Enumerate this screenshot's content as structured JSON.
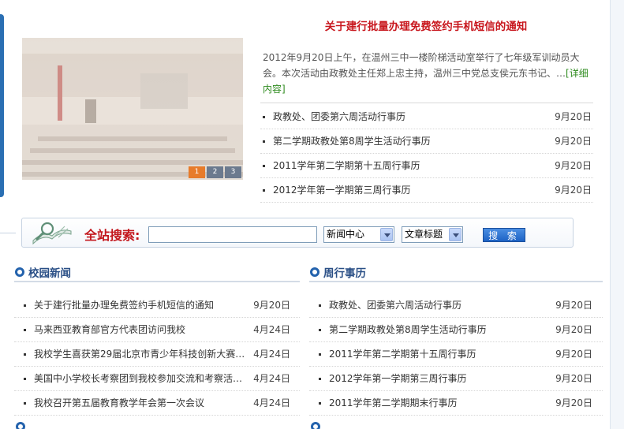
{
  "slideshow": {
    "pages": [
      "1",
      "2",
      "3"
    ],
    "active_page": 1
  },
  "headline": {
    "title": "关于建行批量办理免费签约手机短信的通知",
    "summary": "2012年9月20日上午，在温州三中一楼阶梯活动室举行了七年级军训动员大会。本次活动由政教处主任郑上忠主持，温州三中党总支侯元东书记、…",
    "more": "[详细内容]"
  },
  "top_list": [
    {
      "title": "政教处、团委第六周活动行事历",
      "date": "9月20日"
    },
    {
      "title": "第二学期政教处第8周学生活动行事历",
      "date": "9月20日"
    },
    {
      "title": "2011学年第二学期第十五周行事历",
      "date": "9月20日"
    },
    {
      "title": "2012学年第一学期第三周行事历",
      "date": "9月20日"
    }
  ],
  "search": {
    "title": "全站搜索:",
    "input_value": "",
    "category_selected": "新闻中心",
    "field_selected": "文章标题",
    "button": "搜 索"
  },
  "campus_news": {
    "title": "校园新闻",
    "items": [
      {
        "title": "关于建行批量办理免费签约手机短信的通知",
        "date": "9月20日"
      },
      {
        "title": "马来西亚教育部官方代表团访问我校",
        "date": "4月24日"
      },
      {
        "title": "我校学生喜获第29届北京市青少年科技创新大赛…",
        "date": "4月24日"
      },
      {
        "title": "美国中小学校长考察团到我校参加交流和考察活…",
        "date": "4月24日"
      },
      {
        "title": "我校召开第五届教育教学年会第一次会议",
        "date": "4月24日"
      }
    ]
  },
  "weekly_calendar": {
    "title": "周行事历",
    "items": [
      {
        "title": "政教处、团委第六周活动行事历",
        "date": "9月20日"
      },
      {
        "title": "第二学期政教处第8周学生活动行事历",
        "date": "9月20日"
      },
      {
        "title": "2011学年第二学期第十五周行事历",
        "date": "9月20日"
      },
      {
        "title": "2012学年第一学期第三周行事历",
        "date": "9月20日"
      },
      {
        "title": "2011学年第二学期期末行事历",
        "date": "9月20日"
      }
    ]
  },
  "colors": {
    "headline": "#c8161d",
    "section_title": "#2a4f86",
    "accent_blue": "#2463ad",
    "slide_active": "#e77b2a"
  }
}
